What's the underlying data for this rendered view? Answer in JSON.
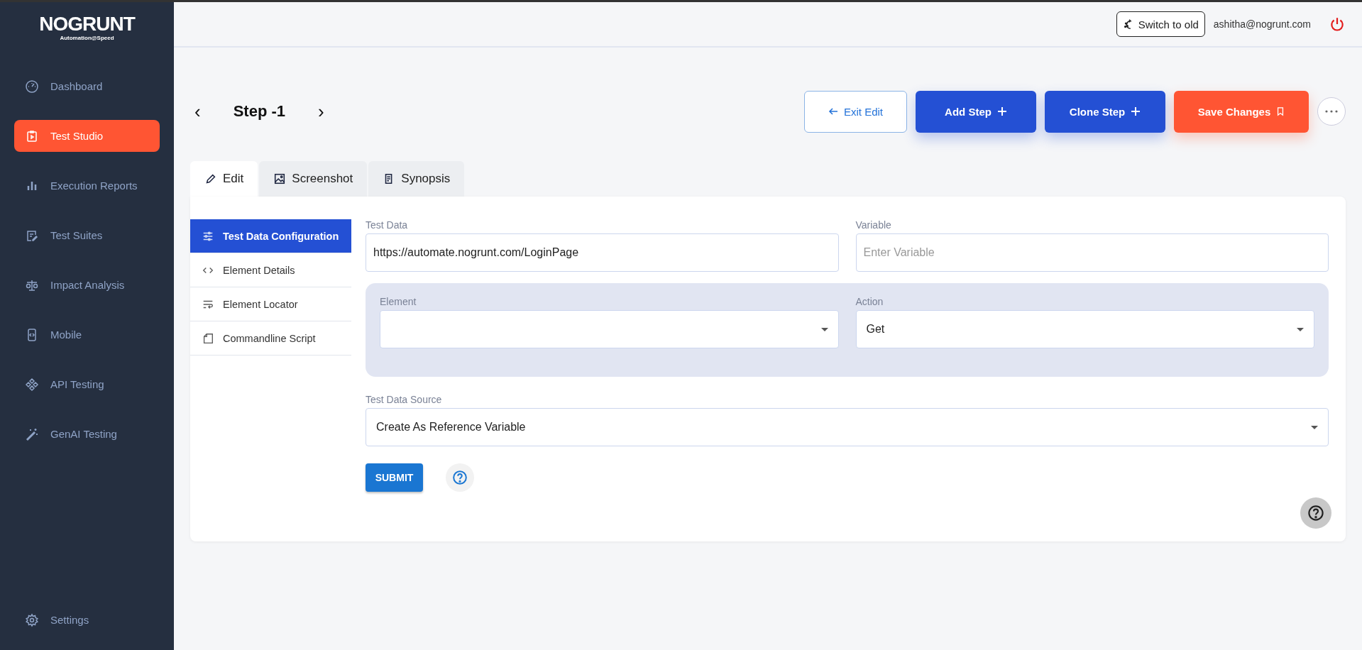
{
  "logo": {
    "name": "NOGRUNT",
    "tagline": "Automation@Speed"
  },
  "sidebar": {
    "items": [
      {
        "label": "Dashboard",
        "selected": false
      },
      {
        "label": "Test Studio",
        "selected": true
      },
      {
        "label": "Execution Reports",
        "selected": false
      },
      {
        "label": "Test Suites",
        "selected": false
      },
      {
        "label": "Impact Analysis",
        "selected": false
      },
      {
        "label": "Mobile",
        "selected": false
      },
      {
        "label": "API Testing",
        "selected": false
      },
      {
        "label": "GenAI Testing",
        "selected": false
      }
    ],
    "settings": "Settings"
  },
  "topbar": {
    "switch_button": "Switch to old",
    "user": "ashitha@nogrunt.com"
  },
  "header": {
    "prev": "‹",
    "title": "Step -1",
    "next": "›"
  },
  "actions": [
    {
      "label": "Exit Edit",
      "kind": "outline"
    },
    {
      "label": "Add Step",
      "kind": "add"
    },
    {
      "label": "Clone Step",
      "kind": "add"
    },
    {
      "label": "Save Changes",
      "kind": "save"
    }
  ],
  "tabs": [
    {
      "label": "Edit",
      "selected": true
    },
    {
      "label": "Screenshot",
      "selected": false
    },
    {
      "label": "Synopsis",
      "selected": false
    }
  ],
  "subnav": [
    {
      "label": "Test Data Configuration",
      "selected": true
    },
    {
      "label": "Element Details",
      "selected": false
    },
    {
      "label": "Element Locator",
      "selected": false
    },
    {
      "label": "Commandline Script",
      "selected": false
    }
  ],
  "form": {
    "test_data": {
      "label": "Test Data",
      "value": "https://automate.nogrunt.com/LoginPage"
    },
    "variable": {
      "label": "Variable",
      "placeholder": "Enter Variable"
    },
    "element": {
      "label": "Element"
    },
    "action": {
      "label": "Action",
      "value": "Get"
    },
    "source": {
      "label": "Test Data Source",
      "value": "Create As Reference Variable"
    },
    "submit": "SUBMIT"
  }
}
